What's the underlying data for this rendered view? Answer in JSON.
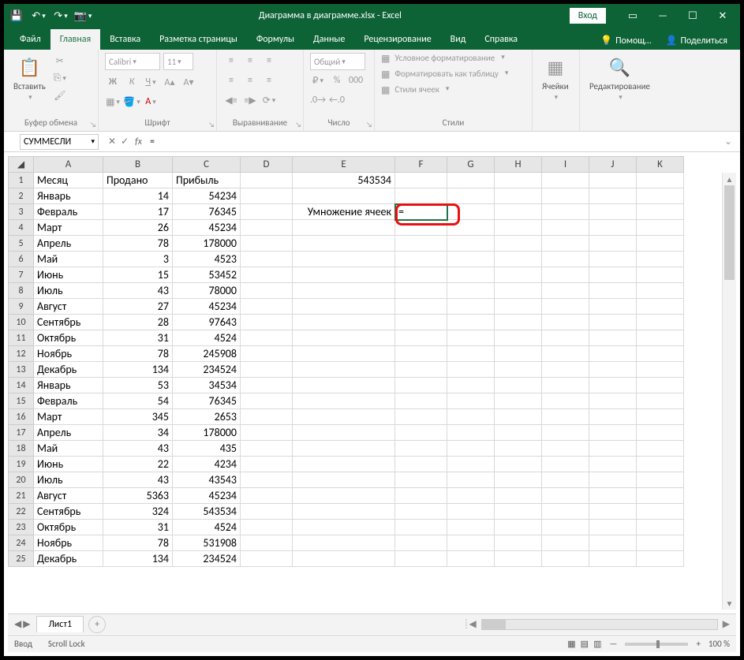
{
  "titlebar": {
    "title": "Диаграмма в диаграмме.xlsx - Excel",
    "login": "Вход"
  },
  "tabs": {
    "file": "Файл",
    "home": "Главная",
    "insert": "Вставка",
    "layout": "Разметка страницы",
    "formulas": "Формулы",
    "data": "Данные",
    "review": "Рецензирование",
    "view": "Вид",
    "help": "Справка",
    "tell_me": "Помощ…",
    "share": "Поделиться"
  },
  "ribbon": {
    "clipboard": {
      "paste": "Вставить",
      "label": "Буфер обмена"
    },
    "font": {
      "name": "Calibri",
      "size": "11",
      "label": "Шрифт"
    },
    "alignment": {
      "label": "Выравнивание"
    },
    "number": {
      "format": "Общий",
      "label": "Число"
    },
    "styles": {
      "cond": "Условное форматирование",
      "table": "Форматировать как таблицу",
      "cell": "Стили ячеек",
      "label": "Стили"
    },
    "cells": {
      "label": "Ячейки"
    },
    "editing": {
      "label": "Редактирование"
    }
  },
  "formula_bar": {
    "name_box": "СУММЕСЛИ",
    "fx": "fx",
    "formula": "="
  },
  "columns": [
    "A",
    "B",
    "C",
    "D",
    "E",
    "F",
    "G",
    "H",
    "I",
    "J",
    "K"
  ],
  "headers": {
    "A": "Месяц",
    "B": "Продано",
    "C": "Прибыль"
  },
  "rows": [
    {
      "n": 1
    },
    {
      "n": 2,
      "A": "Январь",
      "B": 14,
      "C": 54234
    },
    {
      "n": 3,
      "A": "Февраль",
      "B": 17,
      "C": 76345
    },
    {
      "n": 4,
      "A": "Март",
      "B": 26,
      "C": 45234
    },
    {
      "n": 5,
      "A": "Апрель",
      "B": 78,
      "C": 178000
    },
    {
      "n": 6,
      "A": "Май",
      "B": 3,
      "C": 4523
    },
    {
      "n": 7,
      "A": "Июнь",
      "B": 15,
      "C": 53452
    },
    {
      "n": 8,
      "A": "Июль",
      "B": 43,
      "C": 78000
    },
    {
      "n": 9,
      "A": "Август",
      "B": 27,
      "C": 45234
    },
    {
      "n": 10,
      "A": "Сентябрь",
      "B": 28,
      "C": 97643
    },
    {
      "n": 11,
      "A": "Октябрь",
      "B": 31,
      "C": 4524
    },
    {
      "n": 12,
      "A": "Ноябрь",
      "B": 78,
      "C": 245908
    },
    {
      "n": 13,
      "A": "Декабрь",
      "B": 134,
      "C": 234524
    },
    {
      "n": 14,
      "A": "Январь",
      "B": 53,
      "C": 34534
    },
    {
      "n": 15,
      "A": "Февраль",
      "B": 54,
      "C": 76345
    },
    {
      "n": 16,
      "A": "Март",
      "B": 345,
      "C": 2653
    },
    {
      "n": 17,
      "A": "Апрель",
      "B": 34,
      "C": 178000
    },
    {
      "n": 18,
      "A": "Май",
      "B": 43,
      "C": 435
    },
    {
      "n": 19,
      "A": "Июнь",
      "B": 22,
      "C": 4234
    },
    {
      "n": 20,
      "A": "Июль",
      "B": 43,
      "C": 43543
    },
    {
      "n": 21,
      "A": "Август",
      "B": 5363,
      "C": 45234
    },
    {
      "n": 22,
      "A": "Сентябрь",
      "B": 324,
      "C": 543534
    },
    {
      "n": 23,
      "A": "Октябрь",
      "B": 31,
      "C": 4524
    },
    {
      "n": 24,
      "A": "Ноябрь",
      "B": 78,
      "C": 531908
    },
    {
      "n": 25,
      "A": "Декабрь",
      "B": 134,
      "C": 234524
    }
  ],
  "extra": {
    "E1_value": "543534",
    "E3_label": "Умножение ячеек",
    "F3_value": "="
  },
  "sheet_tabs": {
    "sheet1": "Лист1"
  },
  "statusbar": {
    "mode": "Ввод",
    "scroll_lock": "Scroll Lock",
    "zoom": "100 %"
  }
}
